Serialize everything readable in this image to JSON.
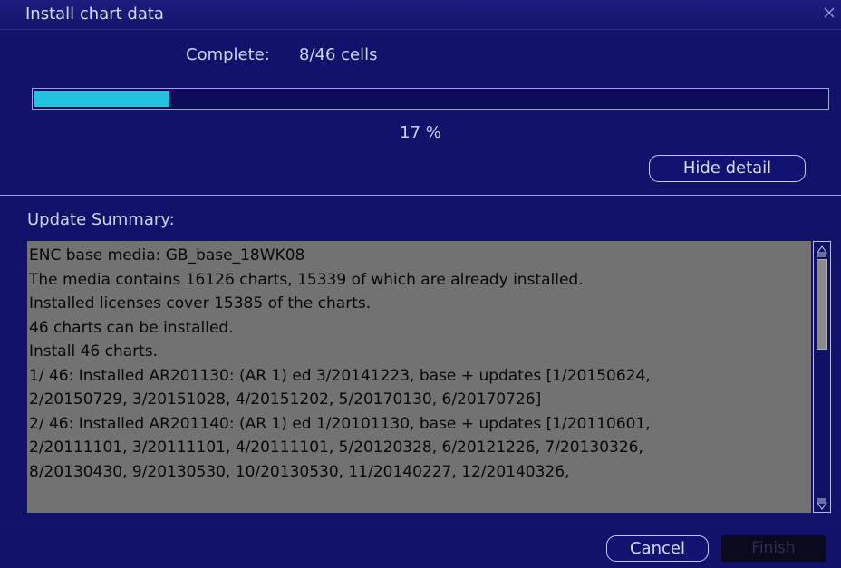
{
  "dialog": {
    "title": "Install chart data"
  },
  "progress": {
    "complete_label": "Complete:",
    "complete_value": "8/46 cells",
    "fraction": 0.17,
    "percent_text": "17 %"
  },
  "buttons": {
    "hide_detail": "Hide detail",
    "cancel": "Cancel",
    "finish": "Finish"
  },
  "summary": {
    "label": "Update Summary:",
    "lines": [
      "ENC base media: GB_base_18WK08",
      "The media contains 16126 charts, 15339 of which are already installed.",
      "Installed licenses cover 15385 of the charts.",
      "46 charts can be installed.",
      "Install 46 charts.",
      "   1/  46: Installed AR201130: (AR 1) ed  3/20141223, base + updates [1/20150624,",
      "2/20150729, 3/20151028, 4/20151202, 5/20170130, 6/20170726]",
      "   2/  46: Installed AR201140: (AR 1) ed  1/20101130, base + updates [1/20110601,",
      "2/20111101, 3/20111101, 4/20111101, 5/20120328, 6/20121226, 7/20130326,",
      "8/20130430, 9/20130530, 10/20130530, 11/20140227, 12/20140326,"
    ]
  },
  "colors": {
    "background": "#12126a",
    "progress_fill": "#21c3e0",
    "summary_bg": "#727272"
  },
  "icons": {
    "close": "close-icon",
    "scroll_up": "scroll-up-arrow-icon",
    "scroll_down": "scroll-down-arrow-icon"
  }
}
